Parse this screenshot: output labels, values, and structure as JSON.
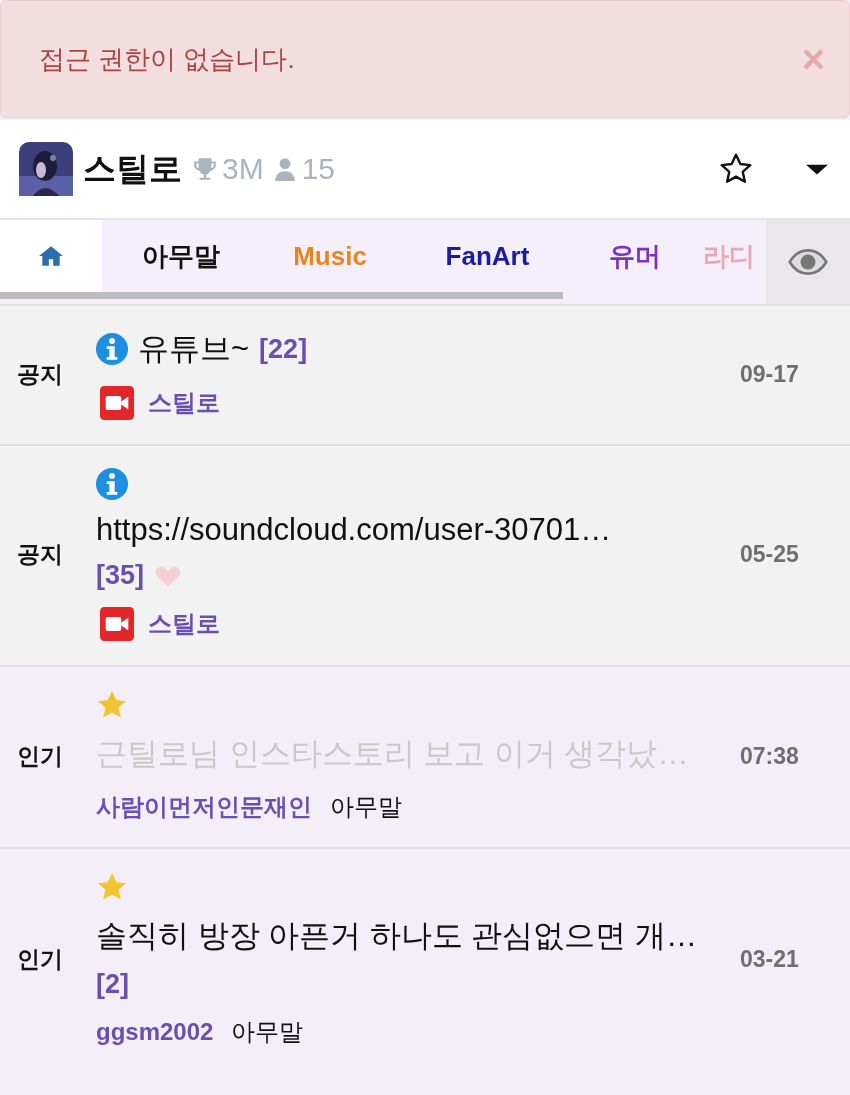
{
  "alert": {
    "message": "접근 권한이 없습니다.",
    "close": "×"
  },
  "channel": {
    "name": "스틸로",
    "trophies": "3M",
    "members": "15",
    "favorited": false
  },
  "tabs": [
    {
      "kind": "home",
      "selected": true,
      "color": "#2a6fb0"
    },
    {
      "kind": "text",
      "label": "아무말",
      "selected": false,
      "color": "#111111"
    },
    {
      "kind": "text",
      "label": "Music",
      "selected": false,
      "color": "#e8851f"
    },
    {
      "kind": "text",
      "label": "FanArt",
      "selected": false,
      "color": "#1c1c9e"
    },
    {
      "kind": "text",
      "label": "유머",
      "selected": false,
      "color": "#7a33c4"
    },
    {
      "kind": "text",
      "label": "라디",
      "selected": false,
      "color": "#e8a9b4"
    }
  ],
  "posts": [
    {
      "kind": "notice",
      "tag": "공지",
      "title": "유튜브~",
      "count": "[22]",
      "liked": false,
      "read": false,
      "author": "스틸로",
      "streamer": true,
      "date": "09-17"
    },
    {
      "kind": "notice",
      "tag": "공지",
      "title": "https://soundcloud.com/user-30701…",
      "count": "[35]",
      "liked": true,
      "read": false,
      "author": "스틸로",
      "streamer": true,
      "date": "05-25"
    },
    {
      "kind": "popular",
      "tag": "인기",
      "title": "근틸로님 인스타스토리 보고 이거 생각났…",
      "liked": false,
      "read": true,
      "author": "사람이먼저인문재인",
      "streamer": false,
      "category": "아무말",
      "date": "07:38"
    },
    {
      "kind": "popular",
      "tag": "인기",
      "title": "솔직히 방장 아픈거 하나도 관심없으면 개…",
      "count": "[2]",
      "liked": false,
      "read": false,
      "author": "ggsm2002",
      "streamer": false,
      "category": "아무말",
      "date": "03-21"
    }
  ]
}
